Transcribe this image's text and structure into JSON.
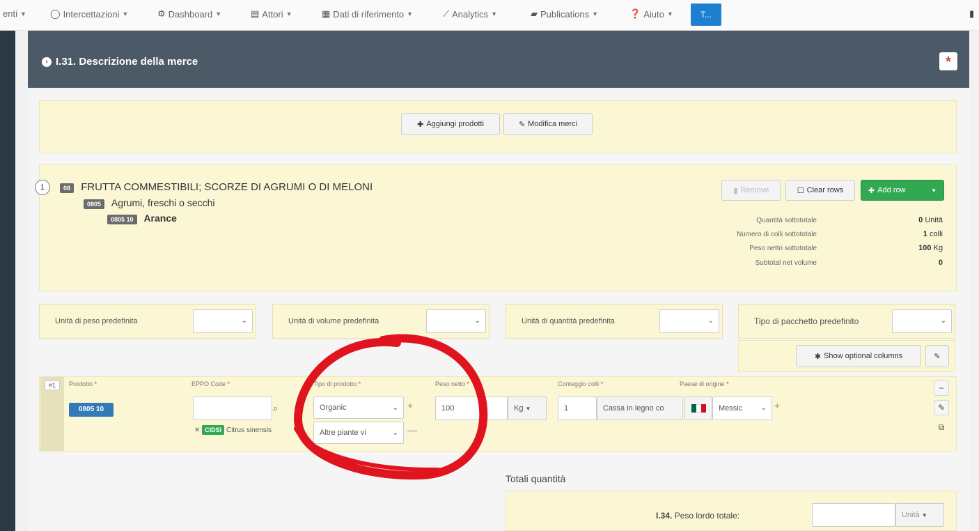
{
  "nav": {
    "items": [
      {
        "label": "enti"
      },
      {
        "label": "Intercettazioni"
      },
      {
        "label": "Dashboard"
      },
      {
        "label": "Attori"
      },
      {
        "label": "Dati di riferimento"
      },
      {
        "label": "Analytics"
      },
      {
        "label": "Publications"
      },
      {
        "label": "Aiuto"
      }
    ],
    "user_initial": "T..."
  },
  "panel": {
    "title": "I.31. Descrizione della merce",
    "required_mark": "*"
  },
  "actions": {
    "add_products": "Aggiungi prodotti",
    "edit_goods": "Modifica merci"
  },
  "product": {
    "number": "1",
    "chapter_code": "08",
    "chapter_label": "FRUTTA COMMESTIBILI; SCORZE DI AGRUMI O DI MELONI",
    "heading_code": "0805",
    "heading_label": "Agrumi, freschi o secchi",
    "subheading_code": "0805 10",
    "subheading_label": "Arance",
    "remove_label": "Remove",
    "clear_rows_label": "Clear rows",
    "add_row_label": "Add row",
    "subtotals": [
      {
        "label": "Quantità sottototale",
        "value": "0",
        "unit": "Unità"
      },
      {
        "label": "Numero di colli sottototale",
        "value": "1",
        "unit": "colli"
      },
      {
        "label": "Peso netto sottototale",
        "value": "100",
        "unit": "Kg"
      },
      {
        "label": "Subtotal net volume",
        "value": "0",
        "unit": ""
      }
    ]
  },
  "defaults": {
    "weight_unit_label": "Unità di peso predefinita",
    "volume_unit_label": "Unità di volume predefinita",
    "quantity_unit_label": "Unità di quantità predefinita",
    "package_type_label": "Tipo di pacchetto predefinito",
    "show_optional_label": "Show optional columns"
  },
  "row": {
    "index": "#1",
    "headers": {
      "product": "Prodotto",
      "eppo": "EPPO Code",
      "product_type": "Tipo di prodotto",
      "net_weight": "Peso netto",
      "package_count": "Conteggio colli",
      "origin": "Paese di origine"
    },
    "product_code": "0805 10",
    "eppo_value": "",
    "eppo_tag": "CIDSI",
    "eppo_name": "Citrus sinensis",
    "product_type_1": "Organic",
    "product_type_2": "Altre piante vi",
    "net_weight": "100",
    "weight_unit": "Kg",
    "package_count": "1",
    "package_type": "Cassa in legno co",
    "origin_country": "Messic"
  },
  "totals": {
    "title": "Totali quantità",
    "gross_weight_label": "Peso lordo totale:",
    "gross_weight_number": "I.34.",
    "gross_weight_unit": "Unità"
  },
  "colors": {
    "header_bg": "#4b5a66",
    "yellow_bg": "#fbf7d5",
    "green_button": "#33a853",
    "blue_chip": "#337ab7",
    "annotation_red": "#e0141e"
  }
}
